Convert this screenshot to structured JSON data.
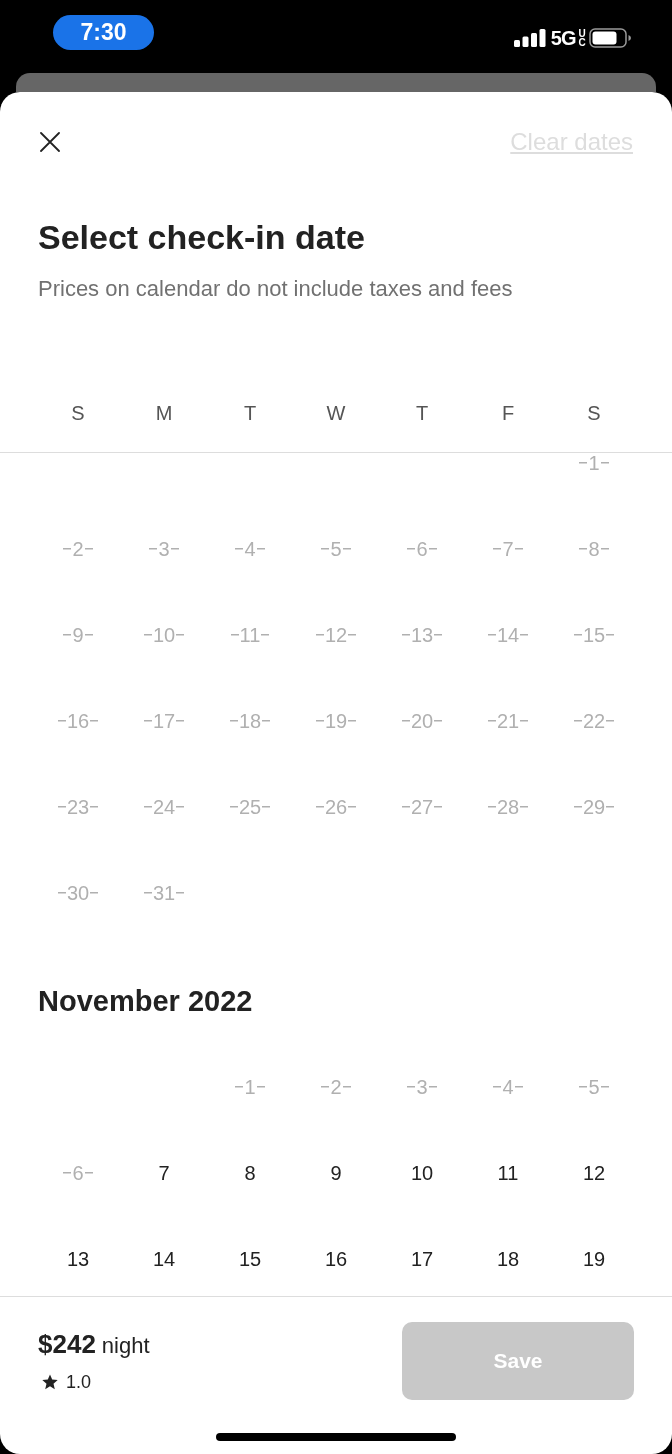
{
  "status_bar": {
    "time": "7:30",
    "network": "5G",
    "network_suffix": "UC"
  },
  "header": {
    "clear_dates": {
      "label": "Clear dates",
      "disabled": true
    }
  },
  "title": "Select check-in date",
  "subtitle": "Prices on calendar do not include taxes and fees",
  "weekdays": [
    "S",
    "M",
    "T",
    "W",
    "T",
    "F",
    "S"
  ],
  "months": [
    {
      "weeks": [
        [
          {
            "kind": "blank"
          },
          {
            "kind": "blank"
          },
          {
            "kind": "blank"
          },
          {
            "kind": "blank"
          },
          {
            "kind": "blank"
          },
          {
            "kind": "blank"
          },
          {
            "kind": "day",
            "day": "1",
            "disabled": true
          }
        ],
        [
          {
            "kind": "day",
            "day": "2",
            "disabled": true
          },
          {
            "kind": "day",
            "day": "3",
            "disabled": true
          },
          {
            "kind": "day",
            "day": "4",
            "disabled": true
          },
          {
            "kind": "day",
            "day": "5",
            "disabled": true
          },
          {
            "kind": "day",
            "day": "6",
            "disabled": true
          },
          {
            "kind": "day",
            "day": "7",
            "disabled": true
          },
          {
            "kind": "day",
            "day": "8",
            "disabled": true
          }
        ],
        [
          {
            "kind": "day",
            "day": "9",
            "disabled": true
          },
          {
            "kind": "day",
            "day": "10",
            "disabled": true
          },
          {
            "kind": "day",
            "day": "11",
            "disabled": true
          },
          {
            "kind": "day",
            "day": "12",
            "disabled": true
          },
          {
            "kind": "day",
            "day": "13",
            "disabled": true
          },
          {
            "kind": "day",
            "day": "14",
            "disabled": true
          },
          {
            "kind": "day",
            "day": "15",
            "disabled": true
          }
        ],
        [
          {
            "kind": "day",
            "day": "16",
            "disabled": true
          },
          {
            "kind": "day",
            "day": "17",
            "disabled": true
          },
          {
            "kind": "day",
            "day": "18",
            "disabled": true
          },
          {
            "kind": "day",
            "day": "19",
            "disabled": true
          },
          {
            "kind": "day",
            "day": "20",
            "disabled": true
          },
          {
            "kind": "day",
            "day": "21",
            "disabled": true
          },
          {
            "kind": "day",
            "day": "22",
            "disabled": true
          }
        ],
        [
          {
            "kind": "day",
            "day": "23",
            "disabled": true
          },
          {
            "kind": "day",
            "day": "24",
            "disabled": true
          },
          {
            "kind": "day",
            "day": "25",
            "disabled": true
          },
          {
            "kind": "day",
            "day": "26",
            "disabled": true
          },
          {
            "kind": "day",
            "day": "27",
            "disabled": true
          },
          {
            "kind": "day",
            "day": "28",
            "disabled": true
          },
          {
            "kind": "day",
            "day": "29",
            "disabled": true
          }
        ],
        [
          {
            "kind": "day",
            "day": "30",
            "disabled": true
          },
          {
            "kind": "day",
            "day": "31",
            "disabled": true
          }
        ]
      ]
    },
    {
      "title": "November 2022",
      "weeks": [
        [
          {
            "kind": "blank"
          },
          {
            "kind": "blank"
          },
          {
            "kind": "day",
            "day": "1",
            "disabled": true
          },
          {
            "kind": "day",
            "day": "2",
            "disabled": true
          },
          {
            "kind": "day",
            "day": "3",
            "disabled": true
          },
          {
            "kind": "day",
            "day": "4",
            "disabled": true
          },
          {
            "kind": "day",
            "day": "5",
            "disabled": true
          }
        ],
        [
          {
            "kind": "day",
            "day": "6",
            "disabled": true
          },
          {
            "kind": "day",
            "day": "7",
            "disabled": false
          },
          {
            "kind": "day",
            "day": "8",
            "disabled": false
          },
          {
            "kind": "day",
            "day": "9",
            "disabled": false
          },
          {
            "kind": "day",
            "day": "10",
            "disabled": false
          },
          {
            "kind": "day",
            "day": "11",
            "disabled": false
          },
          {
            "kind": "day",
            "day": "12",
            "disabled": false
          }
        ],
        [
          {
            "kind": "day",
            "day": "13",
            "disabled": false
          },
          {
            "kind": "day",
            "day": "14",
            "disabled": false
          },
          {
            "kind": "day",
            "day": "15",
            "disabled": false
          },
          {
            "kind": "day",
            "day": "16",
            "disabled": false
          },
          {
            "kind": "day",
            "day": "17",
            "disabled": false
          },
          {
            "kind": "day",
            "day": "18",
            "disabled": false
          },
          {
            "kind": "day",
            "day": "19",
            "disabled": false
          }
        ]
      ]
    }
  ],
  "footer": {
    "price": "$242",
    "unit": "night",
    "rating": "1.0",
    "save_button": {
      "label": "Save",
      "disabled": true
    }
  }
}
